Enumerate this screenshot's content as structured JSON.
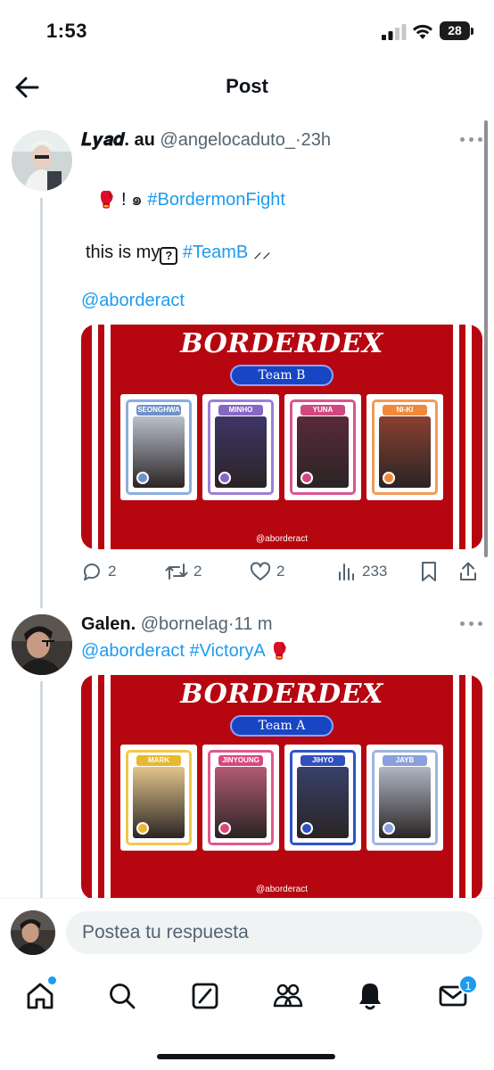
{
  "status_bar": {
    "time": "1:53",
    "battery": "28"
  },
  "header": {
    "title": "Post"
  },
  "tweets": [
    {
      "display_name": "𝑳𝒚𝒂𝒅. au",
      "handle": "@angelocaduto_",
      "separator": "·",
      "time": "23h",
      "line1_tag": "#BordermonFight",
      "line1_prefix": "! ๑",
      "line2_prefix": "this is my",
      "line2_box": "?",
      "line2_tag": "#TeamB",
      "line2_suffix": "⸝⸝",
      "mention": "@aborderact",
      "card": {
        "title": "BORDERDEX",
        "team": "Team B",
        "handle": "@aborderact",
        "members": [
          {
            "name": "SEONGHWA",
            "frame": "#8aaee0",
            "photo": "#b8c0cc",
            "label": "#7090c8"
          },
          {
            "name": "MINHO",
            "frame": "#9b7fd4",
            "photo": "#3f3566",
            "label": "#8766c4"
          },
          {
            "name": "YUNA",
            "frame": "#d8578f",
            "photo": "#5a2a3a",
            "label": "#d04880"
          },
          {
            "name": "NI-KI",
            "frame": "#f29a54",
            "photo": "#8a4030",
            "label": "#ef8a3c"
          }
        ]
      },
      "actions": {
        "replies": "2",
        "reposts": "2",
        "likes": "2",
        "views": "233"
      }
    },
    {
      "display_name": "Galen.",
      "handle": "@bornelag",
      "separator": "·",
      "time": "11 m",
      "mention": "@aborderact",
      "tag": "#VictoryA",
      "card": {
        "title": "BORDERDEX",
        "team": "Team A",
        "handle": "@aborderact",
        "members": [
          {
            "name": "MARK",
            "frame": "#f1c94a",
            "photo": "#e0c48a",
            "label": "#e8b830"
          },
          {
            "name": "JINYOUNG",
            "frame": "#e0588e",
            "photo": "#b25a72",
            "label": "#d8487e"
          },
          {
            "name": "JIHYO",
            "frame": "#2d54c8",
            "photo": "#38406a",
            "label": "#3050c0"
          },
          {
            "name": "JAYB",
            "frame": "#9eb4e6",
            "photo": "#aeb6c2",
            "label": "#8aa0dc"
          }
        ]
      }
    }
  ],
  "reply_bar": {
    "placeholder": "Postea tu respuesta"
  },
  "bottom_nav": {
    "messages_badge": "1"
  },
  "colors": {
    "link": "#1d9bf0",
    "card_red": "#b60710",
    "team_blue": "#1745c4"
  }
}
